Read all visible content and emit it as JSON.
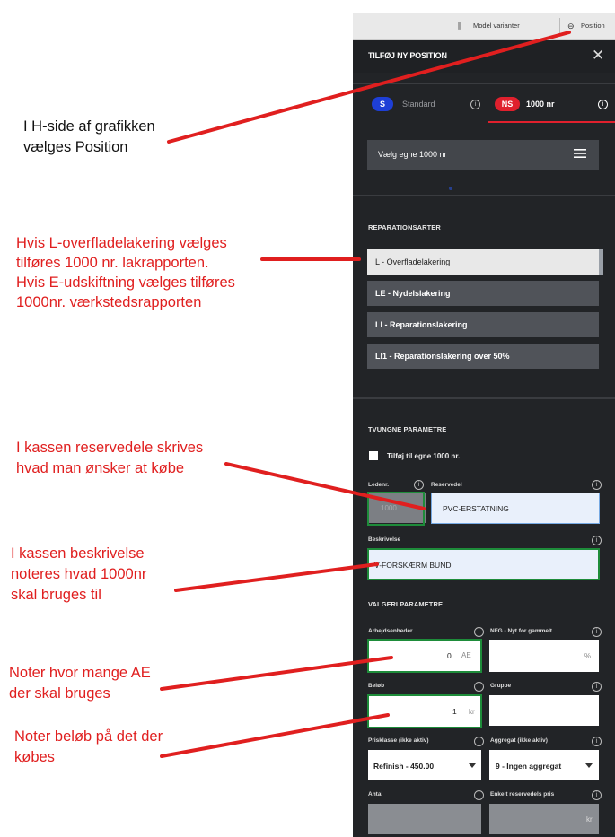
{
  "annotations": [
    {
      "text": "I H-side af grafikken\nvælges Position"
    },
    {
      "text": "Hvis L-overfladelakering vælges\ntilføres 1000 nr. lakrapporten.\nHvis E-udskiftning vælges tilføres\n1000nr. værkstedsrapporten"
    },
    {
      "text": "I kassen reservedele skrives\nhvad man ønsker at købe"
    },
    {
      "text": "I kassen beskrivelse\nnoteres hvad 1000nr\nskal bruges til"
    },
    {
      "text": "Noter hvor mange AE\nder skal bruges"
    },
    {
      "text": "Noter beløb på det der\nkøbes"
    }
  ],
  "topbar": {
    "model_varianter": "Model varianter",
    "position": "Position"
  },
  "panel": {
    "title": "TILFØJ NY POSITION",
    "tabs": [
      {
        "badge": "S",
        "label": "Standard",
        "badge_color": "#1e3fd6"
      },
      {
        "badge": "NS",
        "label": "1000 nr",
        "badge_color": "#e0202d"
      }
    ],
    "select_label": "Vælg egne 1000 nr",
    "reparation_heading": "REPARATIONSARTER",
    "reparation_items": [
      "L - Overfladelakering",
      "LE - Nydelslakering",
      "LI - Reparationslakering",
      "LI1 - Reparationslakering over 50%"
    ],
    "tvungne_heading": "TVUNGNE PARAMETRE",
    "checkbox_label": "Tilføj til egne 1000 nr.",
    "ledenr_label": "Ledenr.",
    "ledenr_value": "1000",
    "reservedel_label": "Reservedel",
    "reservedel_value": "PVC-ERSTATNING",
    "beskrivelse_label": "Beskrivelse",
    "beskrivelse_value": "V-FORSKÆRM BUND",
    "valgfri_heading": "VALGFRI PARAMETRE",
    "arbejdsenheder_label": "Arbejdsenheder",
    "arbejdsenheder_value": "0",
    "arbejdsenheder_unit": "AE",
    "nfg_label": "NFG - Nyt for gammelt",
    "nfg_unit": "%",
    "belob_label": "Beløb",
    "belob_value": "1",
    "belob_unit": "kr",
    "gruppe_label": "Gruppe",
    "prisklasse_label": "Prisklasse (ikke aktiv)",
    "prisklasse_value": "Refinish - 450.00",
    "aggregat_label": "Aggregat (ikke aktiv)",
    "aggregat_value": "9 - Ingen aggregat",
    "antal_label": "Antal",
    "enkelt_label": "Enkelt reservedels pris",
    "enkelt_unit": "kr"
  },
  "colors": {
    "annotation_red": "#e01f1f",
    "highlight_green": "#1e8c3a",
    "panel_bg": "#222427"
  }
}
